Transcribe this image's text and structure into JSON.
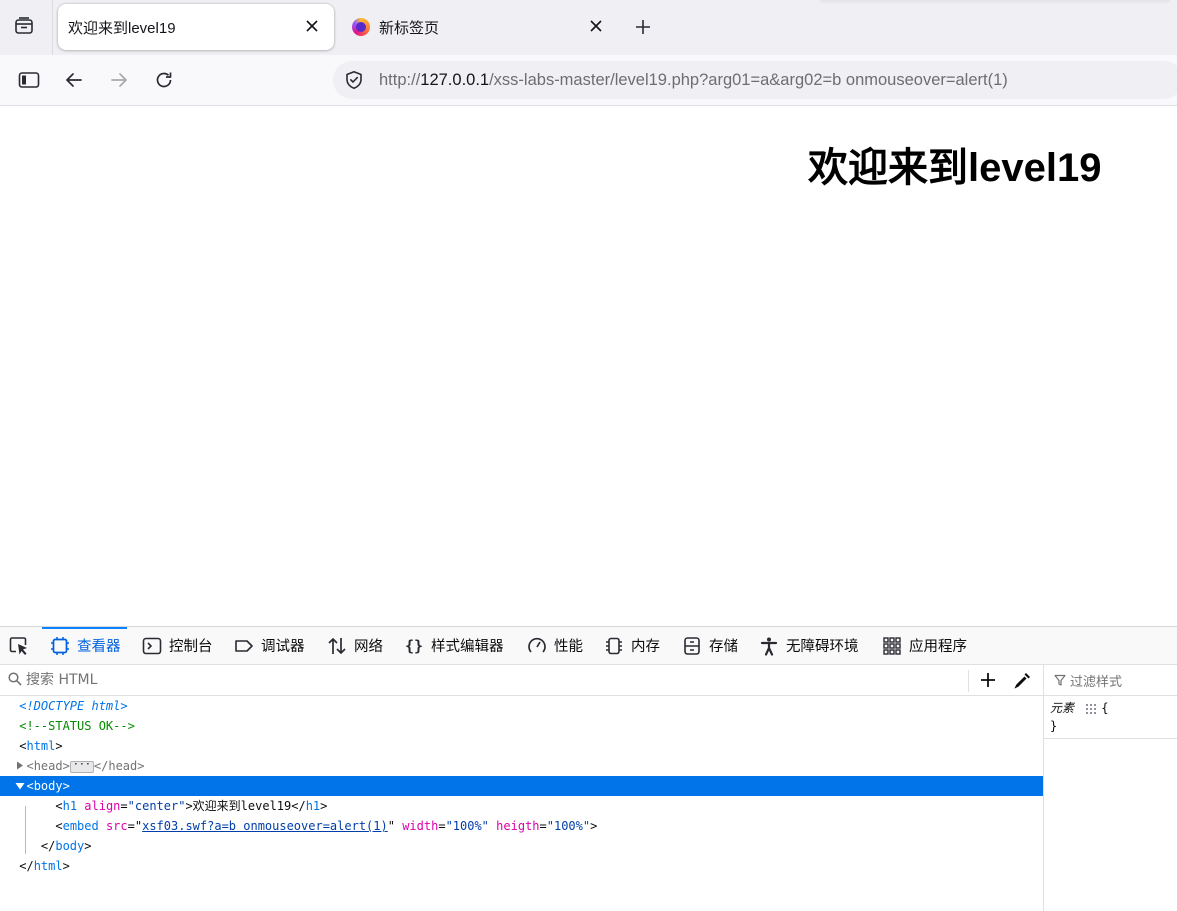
{
  "browser": {
    "tabs": [
      {
        "title": "欢迎来到level19",
        "active": true
      },
      {
        "title": "新标签页",
        "active": false
      }
    ],
    "url": {
      "scheme": "http://",
      "host": "127.0.0.1",
      "path": "/xss-labs-master/level19.php?arg01=a&arg02=b onmouseover=alert(1)"
    }
  },
  "page": {
    "heading": "欢迎来到level19"
  },
  "devtools": {
    "tabs": [
      {
        "label": "查看器",
        "icon": "inspector-icon",
        "selected": true
      },
      {
        "label": "控制台",
        "icon": "console-icon",
        "selected": false
      },
      {
        "label": "调试器",
        "icon": "debugger-icon",
        "selected": false
      },
      {
        "label": "网络",
        "icon": "network-icon",
        "selected": false
      },
      {
        "label": "样式编辑器",
        "icon": "style-editor-icon",
        "selected": false
      },
      {
        "label": "性能",
        "icon": "performance-icon",
        "selected": false
      },
      {
        "label": "内存",
        "icon": "memory-icon",
        "selected": false
      },
      {
        "label": "存储",
        "icon": "storage-icon",
        "selected": false
      },
      {
        "label": "无障碍环境",
        "icon": "accessibility-icon",
        "selected": false
      },
      {
        "label": "应用程序",
        "icon": "application-icon",
        "selected": false
      }
    ],
    "search_placeholder": "搜索 HTML",
    "filter_styles_placeholder": "过滤样式",
    "markup": {
      "doctype": "<!DOCTYPE html>",
      "comment": "<!--STATUS OK-->",
      "html_open": "html",
      "head": "head",
      "body": "body",
      "h1": {
        "tag": "h1",
        "attr": "align",
        "value": "\"center\"",
        "text": "欢迎来到level19"
      },
      "embed": {
        "tag": "embed",
        "src_attr": "src",
        "src_value": "xsf03.swf?a=b onmouseover=alert(1)",
        "width_attr": "width",
        "width_value": "\"100%\"",
        "heigth_attr": "heigth",
        "heigth_value": "\"100%\""
      }
    },
    "rules": {
      "selector": "元素",
      "open": "{",
      "close": "}"
    }
  },
  "colors": {
    "accent": "#0060df",
    "selection": "#0074e8",
    "attr_name": "#dd00a9",
    "attr_value": "#003eaa",
    "comment": "#058b00"
  }
}
